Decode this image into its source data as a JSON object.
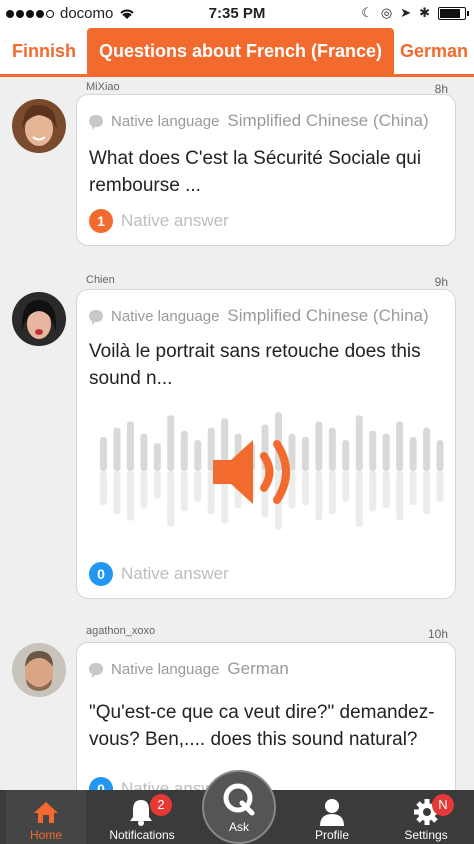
{
  "status": {
    "carrier": "docomo",
    "time": "7:35 PM"
  },
  "tabs": [
    {
      "label": "Finnish"
    },
    {
      "label": "Questions about French (France)"
    },
    {
      "label": "German"
    }
  ],
  "posts": [
    {
      "username": "MiXiao",
      "ago": "8h",
      "native_label": "Native language",
      "language": "Simplified Chinese (China)",
      "question": "What does C'est la Sécurité Sociale qui rembourse ...",
      "answer_count": "1",
      "answer_label": "Native answer"
    },
    {
      "username": "Chien",
      "ago": "9h",
      "native_label": "Native language",
      "language": "Simplified Chinese (China)",
      "question": "Voilà le portrait sans retouche  does this sound n...",
      "answer_count": "0",
      "answer_label": "Native answer"
    },
    {
      "username": "agathon_xoxo",
      "ago": "10h",
      "native_label": "Native language",
      "language": "German",
      "question": "\"Qu'est-ce que ca veut dire?\" demandez-vous? Ben,.... does this sound natural?",
      "answer_count": "0",
      "answer_label": "Native answer"
    }
  ],
  "tabbar": {
    "home": "Home",
    "notifications": "Notifications",
    "notifications_badge": "2",
    "ask": "Ask",
    "profile": "Profile",
    "settings": "Settings",
    "settings_badge": "N"
  },
  "colors": {
    "accent": "#f26a2d",
    "blue": "#2196f3",
    "tabbar": "#3b3b3b"
  },
  "wave_bars": [
    0.55,
    0.7,
    0.8,
    0.6,
    0.45,
    0.9,
    0.65,
    0.5,
    0.7,
    0.85,
    0.6,
    0.45,
    0.75,
    0.95,
    0.6,
    0.55,
    0.8,
    0.7,
    0.5,
    0.9,
    0.65,
    0.6,
    0.8,
    0.55,
    0.7,
    0.5
  ]
}
